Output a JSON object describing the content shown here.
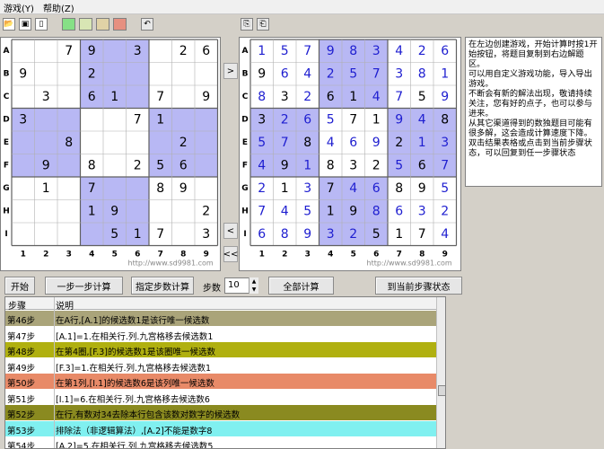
{
  "menu": [
    "游戏(Y)",
    "帮助(Z)"
  ],
  "toolbar": {
    "colors": [
      "#86e086",
      "#d8e6b4",
      "#e0d2a6",
      "#e69080"
    ]
  },
  "left_board": {
    "watermark": "http://www.sd9981.com",
    "cells": [
      "  79 3 26",
      "9  2     ",
      " 3 61 7 9",
      "3    71  8",
      "  8    2  ",
      " 9 8 256 ",
      " 1 7  89 ",
      "   19   2",
      "    517 3"
    ]
  },
  "right_board": {
    "watermark": "http://www.sd9981.com",
    "cells": [
      "157983426",
      "964257381",
      "832614759",
      "326571948",
      "578469213",
      "491832567",
      "213746895",
      "745198632",
      "689325174"
    ],
    "blue_digits": [
      "111111111",
      "011111111",
      "101001101",
      "011100110",
      "110111011",
      "101000101",
      "101011001",
      "111001111",
      "111110001"
    ]
  },
  "row_labels": [
    "A",
    "B",
    "C",
    "D",
    "E",
    "F",
    "G",
    "H",
    "I"
  ],
  "col_labels": [
    "1",
    "2",
    "3",
    "4",
    "5",
    "6",
    "7",
    "8",
    "9"
  ],
  "nav": {
    "right": ">",
    "left": "<",
    "back": "<<"
  },
  "info_text": "在左边创建游戏，开始计算时按1开始按钮，将题目复制到右边解题区。\n可以用自定义游戏功能，导入导出游戏。\n不断会有新的解法出现，敬请持续关注，您有好的点子，也可以参与进来。\n从其它渠道得到的数独题目可能有很多解，这会造成计算速度下降。\n双击结果表格或点击到当前步骤状态，可以回复到任一步骤状态",
  "controls": {
    "start": "开始",
    "step_by_step": "一步一步计算",
    "fixed_steps": "指定步数计算",
    "steps_label": "步数",
    "steps_value": "10",
    "calc_all": "全部计算",
    "to_current": "到当前步骤状态"
  },
  "table": {
    "headers": [
      "步骤",
      "说明"
    ],
    "rows": [
      {
        "step": "第46步",
        "desc": "在A行,[A.1]的候选数1是该行唯一候选数",
        "bg": "#aaa47a"
      },
      {
        "step": "第47步",
        "desc": "[A.1]=1.在相关行.列.九宫格移去候选数1",
        "bg": "#ffffff"
      },
      {
        "step": "第48步",
        "desc": "在第4圈,[F.3]的候选数1是该圈唯一候选数",
        "bg": "#b0b010"
      },
      {
        "step": "第49步",
        "desc": "[F.3]=1.在相关行.列.九宫格移去候选数1",
        "bg": "#ffffff"
      },
      {
        "step": "第50步",
        "desc": "在第1列,[I.1]的候选数6是该列唯一候选数",
        "bg": "#e88a68"
      },
      {
        "step": "第51步",
        "desc": "[I.1]=6.在相关行.列.九宫格移去候选数6",
        "bg": "#ffffff"
      },
      {
        "step": "第52步",
        "desc": "在行,有数对34去除本行包含该数对数字的候选数",
        "bg": "#8a8a20"
      },
      {
        "step": "第53步",
        "desc": "排除法（非逻辑算法）,[A.2]不能是数字8",
        "bg": "#80f0f0"
      },
      {
        "step": "第54步",
        "desc": "[A.2]=5.在相关行.列.九宫格移去候选数5",
        "bg": "#ffffff"
      }
    ]
  }
}
